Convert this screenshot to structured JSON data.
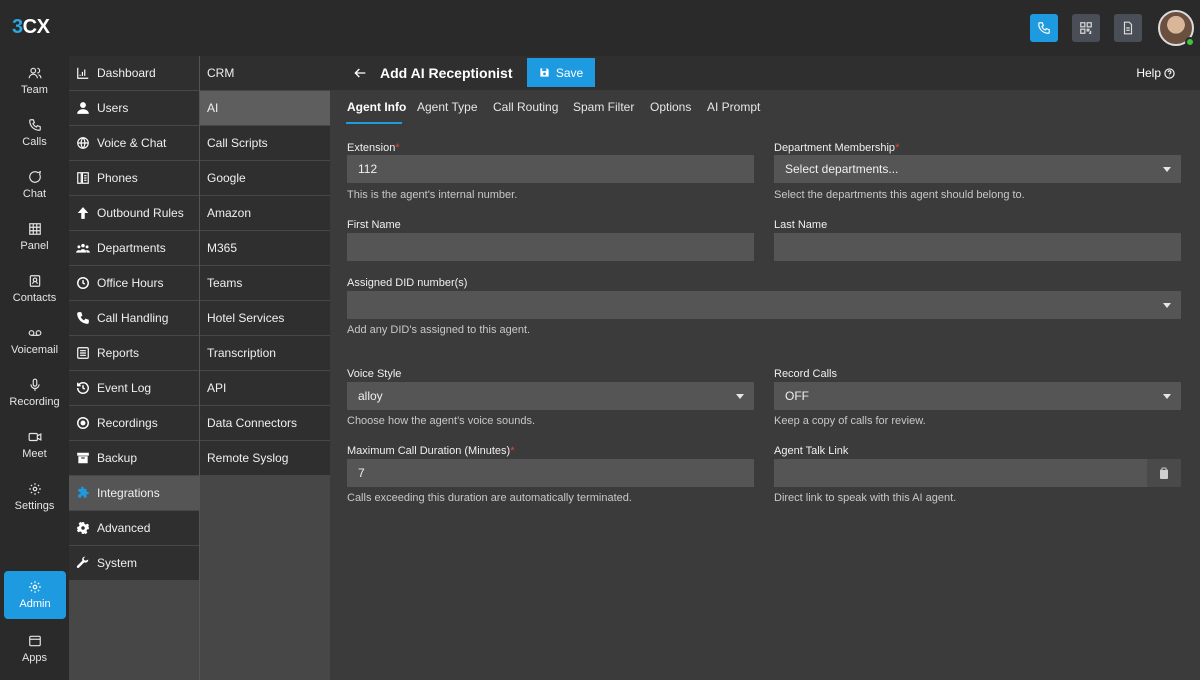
{
  "app": {
    "logo": "3CX"
  },
  "rail": [
    {
      "label": "Team",
      "icon": "team-icon"
    },
    {
      "label": "Calls",
      "icon": "calls-icon"
    },
    {
      "label": "Chat",
      "icon": "chat-icon"
    },
    {
      "label": "Panel",
      "icon": "panel-icon"
    },
    {
      "label": "Contacts",
      "icon": "contacts-icon"
    },
    {
      "label": "Voicemail",
      "icon": "voicemail-icon"
    },
    {
      "label": "Recording",
      "icon": "microphone-icon"
    },
    {
      "label": "Meet",
      "icon": "video-icon"
    },
    {
      "label": "Settings",
      "icon": "gear-icon"
    },
    {
      "label": "Admin",
      "icon": "admin-gear-icon"
    },
    {
      "label": "Apps",
      "icon": "apps-icon"
    }
  ],
  "nav": [
    {
      "label": "Dashboard",
      "icon": "dashboard-icon"
    },
    {
      "label": "Users",
      "icon": "user-icon"
    },
    {
      "label": "Voice & Chat",
      "icon": "globe-icon"
    },
    {
      "label": "Phones",
      "icon": "phone-device-icon"
    },
    {
      "label": "Outbound Rules",
      "icon": "arrow-up-icon"
    },
    {
      "label": "Departments",
      "icon": "people-group-icon"
    },
    {
      "label": "Office Hours",
      "icon": "clock-icon"
    },
    {
      "label": "Call Handling",
      "icon": "phone-icon"
    },
    {
      "label": "Reports",
      "icon": "list-icon"
    },
    {
      "label": "Event Log",
      "icon": "history-icon"
    },
    {
      "label": "Recordings",
      "icon": "record-icon"
    },
    {
      "label": "Backup",
      "icon": "archive-icon"
    },
    {
      "label": "Integrations",
      "icon": "puzzle-icon"
    },
    {
      "label": "Advanced",
      "icon": "cog-icon"
    },
    {
      "label": "System",
      "icon": "wrench-icon"
    }
  ],
  "sub": [
    "CRM",
    "AI",
    "Call Scripts",
    "Google",
    "Amazon",
    "M365",
    "Teams",
    "Hotel Services",
    "Transcription",
    "API",
    "Data Connectors",
    "Remote Syslog"
  ],
  "header": {
    "title": "Add AI Receptionist",
    "save_label": "Save",
    "help_label": "Help"
  },
  "tabs": [
    "Agent Info",
    "Agent Type",
    "Call Routing",
    "Spam Filter",
    "Options",
    "AI Prompt"
  ],
  "form": {
    "extension": {
      "label": "Extension",
      "required": "*",
      "value": "112",
      "helper": "This is the agent's internal number."
    },
    "department": {
      "label": "Department Membership",
      "required": "*",
      "value": "Select departments...",
      "helper": "Select the departments this agent should belong to."
    },
    "first_name": {
      "label": "First Name",
      "value": ""
    },
    "last_name": {
      "label": "Last Name",
      "value": ""
    },
    "did": {
      "label": "Assigned DID number(s)",
      "value": "",
      "helper": "Add any DID's assigned to this agent."
    },
    "voice_style": {
      "label": "Voice Style",
      "value": "alloy",
      "helper": "Choose how the agent's voice sounds."
    },
    "record_calls": {
      "label": "Record Calls",
      "value": "OFF",
      "helper": "Keep a copy of calls for review."
    },
    "max_duration": {
      "label": "Maximum Call Duration (Minutes)",
      "required": "*",
      "value": "7",
      "helper": "Calls exceeding this duration are automatically terminated."
    },
    "talk_link": {
      "label": "Agent Talk Link",
      "value": "",
      "helper": "Direct link to speak with this AI agent."
    }
  },
  "colors": {
    "accent": "#1e9be0",
    "required": "#e0453a"
  }
}
